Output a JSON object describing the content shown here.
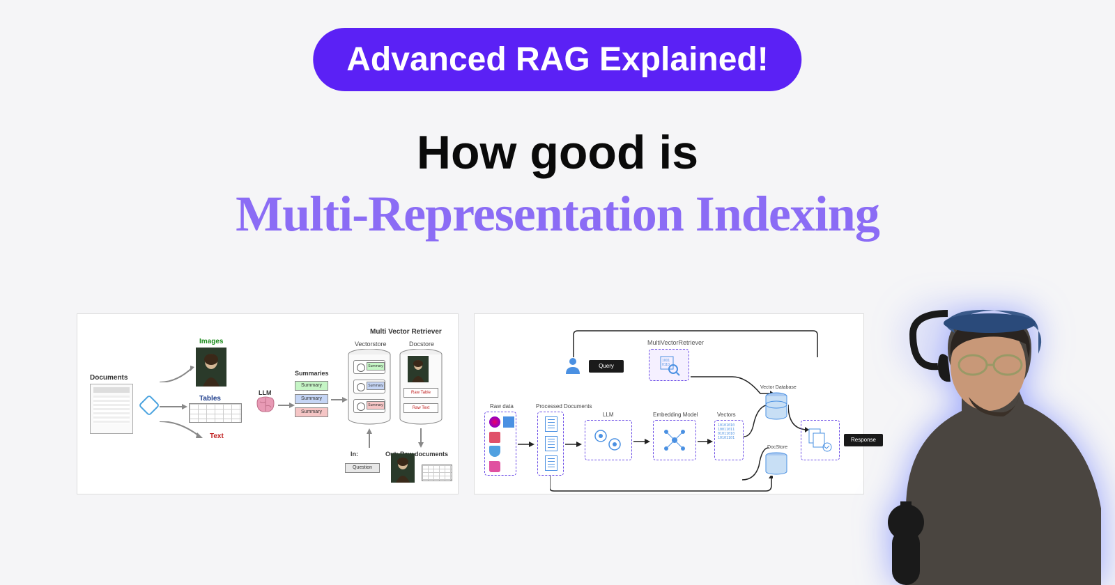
{
  "badge": "Advanced RAG Explained!",
  "headline_1": "How good is",
  "headline_2": "Multi-Representation Indexing",
  "diagram1": {
    "documents": "Documents",
    "images": "Images",
    "tables": "Tables",
    "text": "Text",
    "llm": "LLM",
    "summaries": "Summaries",
    "summary_tag": "Summary",
    "mvr_title": "Multi Vector Retriever",
    "vectorstore": "Vectorstore",
    "docstore": "Docstore",
    "raw_table": "Raw Table",
    "raw_text": "Raw Text",
    "in": "In:",
    "out": "Out: Raw documents",
    "question": "Question"
  },
  "diagram2": {
    "query": "Query",
    "mvr": "MultiVectorRetriever",
    "raw_data": "Raw data",
    "processed": "Processed Documents",
    "llm": "LLM",
    "embedding": "Embedding Model",
    "vectors": "Vectors",
    "vector_db": "Vector Database",
    "docstore": "DocStore",
    "response": "Response",
    "bits": "10101010\n10011011\n01011010\n10101101"
  }
}
